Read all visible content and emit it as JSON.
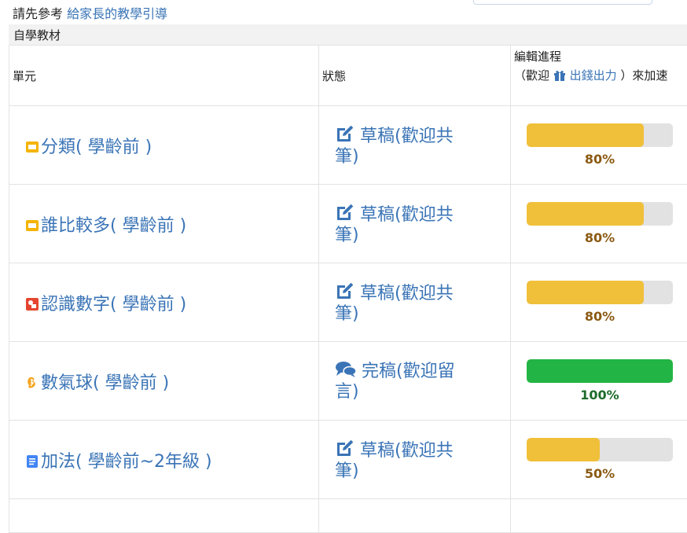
{
  "header": {
    "prefix": "請先參考",
    "guide_link": "給家長的教學引導"
  },
  "table": {
    "caption": "自學教材",
    "col_unit": "單元",
    "col_status": "狀態",
    "col_edit_line1": "編輯進程",
    "col_edit_open": "（歡迎",
    "col_edit_gift": "出錢出力",
    "col_edit_close": "）來加速",
    "rows": [
      {
        "title": "分類( 學齡前 )",
        "icon": "slides-icon",
        "icon_color": "#f4b400",
        "status": "草稿(歡迎共筆)",
        "status_icon": "edit-icon",
        "progress": 80,
        "progress_label": "80%",
        "bar_color": "#f0c03a",
        "label_color": "#8a5a12"
      },
      {
        "title": "誰比較多( 學齡前 )",
        "icon": "slides-icon",
        "icon_color": "#f4b400",
        "status": "草稿(歡迎共筆)",
        "status_icon": "edit-icon",
        "progress": 80,
        "progress_label": "80%",
        "bar_color": "#f0c03a",
        "label_color": "#8a5a12"
      },
      {
        "title": "認識數字( 學齡前 )",
        "icon": "jamboard-icon",
        "icon_color": "#e5452f",
        "status": "草稿(歡迎共筆)",
        "status_icon": "edit-icon",
        "progress": 80,
        "progress_label": "80%",
        "bar_color": "#f0c03a",
        "label_color": "#8a5a12"
      },
      {
        "title": "數氣球( 學齡前 )",
        "icon": "scratch-icon",
        "icon_color": "#f5a623",
        "status": "完稿(歡迎留言)",
        "status_icon": "comments-icon",
        "progress": 100,
        "progress_label": "100%",
        "bar_color": "#22b545",
        "label_color": "#1d6b2a"
      },
      {
        "title": "加法( 學齡前~2年級 )",
        "icon": "document-icon",
        "icon_color": "#4285f4",
        "status": "草稿(歡迎共筆)",
        "status_icon": "edit-icon",
        "progress": 50,
        "progress_label": "50%",
        "bar_color": "#f0c03a",
        "label_color": "#8a5a12"
      }
    ]
  }
}
